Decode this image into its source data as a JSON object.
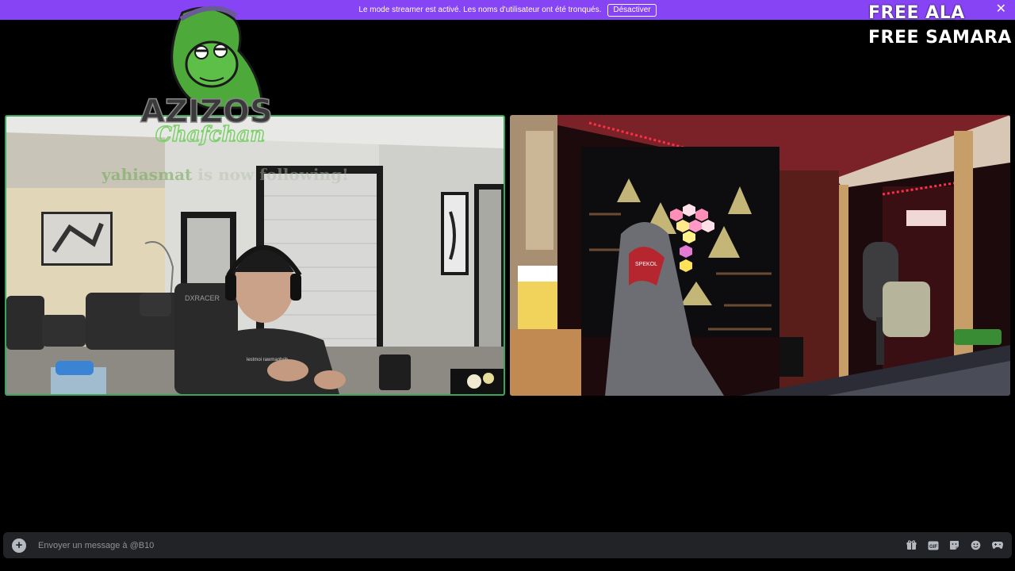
{
  "banner": {
    "message": "Le mode streamer est activé. Les noms d'utilisateur ont été tronqués.",
    "disable_label": "Désactiver",
    "close_glyph": "✕"
  },
  "overlay": {
    "line1": "FREE ALA",
    "line2": "FREE SAMARA",
    "logo_text": "AZIZOS",
    "logo_script": "Chafchan",
    "follow_name": "yahiasmat",
    "follow_text": "is now following!"
  },
  "tiles": [
    {
      "id": "left",
      "speaking": true,
      "accent": "#3ba55c"
    },
    {
      "id": "right",
      "speaking": false
    }
  ],
  "message_bar": {
    "placeholder": "Envoyer un message à @B10",
    "add_glyph": "+",
    "icons": [
      "gift-icon",
      "gif-icon",
      "sticker-icon",
      "emoji-icon",
      "activity-icon"
    ]
  },
  "colors": {
    "banner": "#8744f5",
    "speaking_border": "#3ba55c",
    "background": "#000000",
    "input_bg": "#222327"
  }
}
